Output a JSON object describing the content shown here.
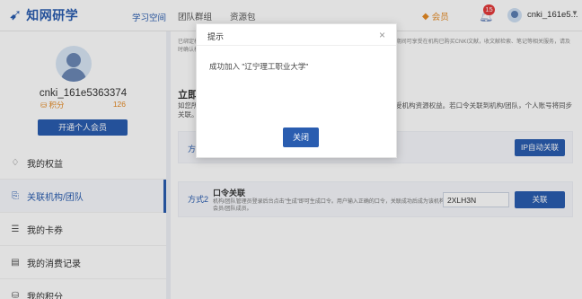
{
  "header": {
    "logo_text": "知网研学",
    "study_space": "学习空间",
    "nav": [
      "团队群组",
      "资源包"
    ],
    "vip_label": "会员",
    "notification_count": "15",
    "user_name": "cnki_161e5..."
  },
  "sidebar": {
    "username": "cnki_161e5363374",
    "points_label": "积分",
    "points_value": "126",
    "open_vip_label": "开通个人会员",
    "items": [
      {
        "label": "我的权益",
        "icon": "diamond-icon",
        "active": false
      },
      {
        "label": "关联机构/团队",
        "icon": "link-doc-icon",
        "active": true
      },
      {
        "label": "我的卡券",
        "icon": "ticket-icon",
        "active": false
      },
      {
        "label": "我的消费记录",
        "icon": "receipt-icon",
        "active": false
      },
      {
        "label": "我的积分",
        "icon": "coin-icon",
        "active": false
      }
    ]
  },
  "main": {
    "notice": "已绑定机构后，您可以在机构IP范围外使用机构已购买的资源（以机构实际开通为准）。关联期间可享受在机构已购买CNKI文献，收文献检索、笔记等相关服务，请及时确认机构或团队关联状态。",
    "section_title": "立即关联",
    "section_desc": "如您所在的机构/团队已开通相关服务，可通过以下方式关联，成功后将享受机构资源权益。若口令关联到机构/团队，个人账号将同步关联。",
    "ip_method_label": "方式1",
    "ip_button_label": "IP自动关联",
    "pw_method_label": "方式2",
    "pw_title": "口令关联",
    "pw_desc": "机构/团队管理员登录后台点击\"生成\"即可生成口令。用户输入正确的口令，关联成功后成为该机构会员/团队成员。",
    "pw_value": "2XLH3N",
    "pw_button_label": "关联"
  },
  "modal": {
    "title": "提示",
    "close_glyph": "×",
    "message": "成功加入 \"辽宁理工职业大学\"",
    "button_label": "关闭"
  }
}
